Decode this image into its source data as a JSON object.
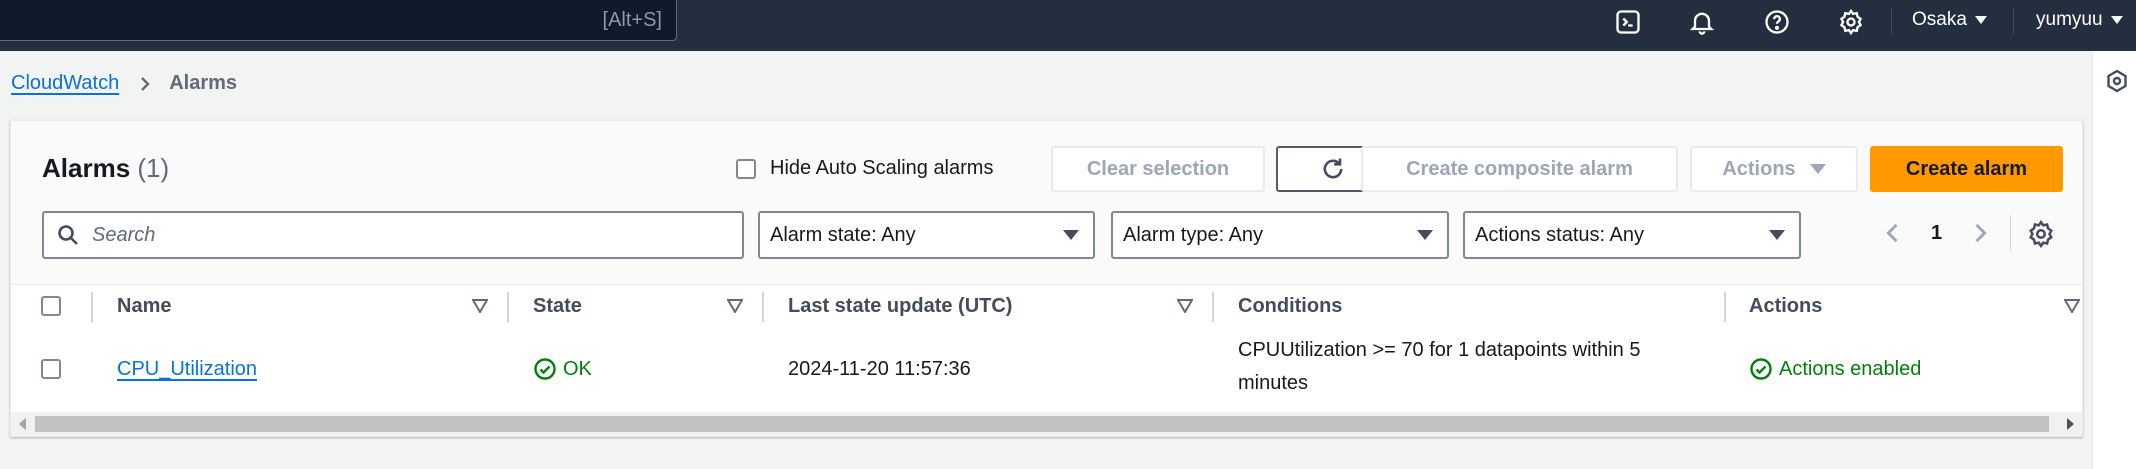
{
  "topbar": {
    "search_shortcut": "[Alt+S]",
    "region": "Osaka",
    "user": "yumyuu",
    "icons": [
      "cloudshell-icon",
      "bell-icon",
      "help-icon",
      "settings-icon"
    ]
  },
  "breadcrumb": {
    "root": "CloudWatch",
    "current": "Alarms"
  },
  "header": {
    "title": "Alarms",
    "count": "(1)",
    "hide_asg_label": "Hide Auto Scaling alarms",
    "clear_selection": "Clear selection",
    "create_composite": "Create composite alarm",
    "actions": "Actions",
    "create_alarm": "Create alarm"
  },
  "filters": {
    "search_placeholder": "Search",
    "alarm_state": "Alarm state: Any",
    "alarm_type": "Alarm type: Any",
    "actions_status": "Actions status: Any"
  },
  "pagination": {
    "page": "1"
  },
  "table": {
    "columns": [
      "Name",
      "State",
      "Last state update (UTC)",
      "Conditions",
      "Actions"
    ],
    "rows": [
      {
        "name": "CPU_Utilization",
        "state": "OK",
        "last_update": "2024-11-20 11:57:36",
        "conditions": "CPUUtilization >= 70 for 1 datapoints within 5 minutes",
        "actions": "Actions enabled"
      }
    ]
  },
  "colors": {
    "topbar_bg": "#232f3e",
    "primary_button": "#ff9900",
    "link": "#0972d3",
    "success": "#037f0c"
  }
}
